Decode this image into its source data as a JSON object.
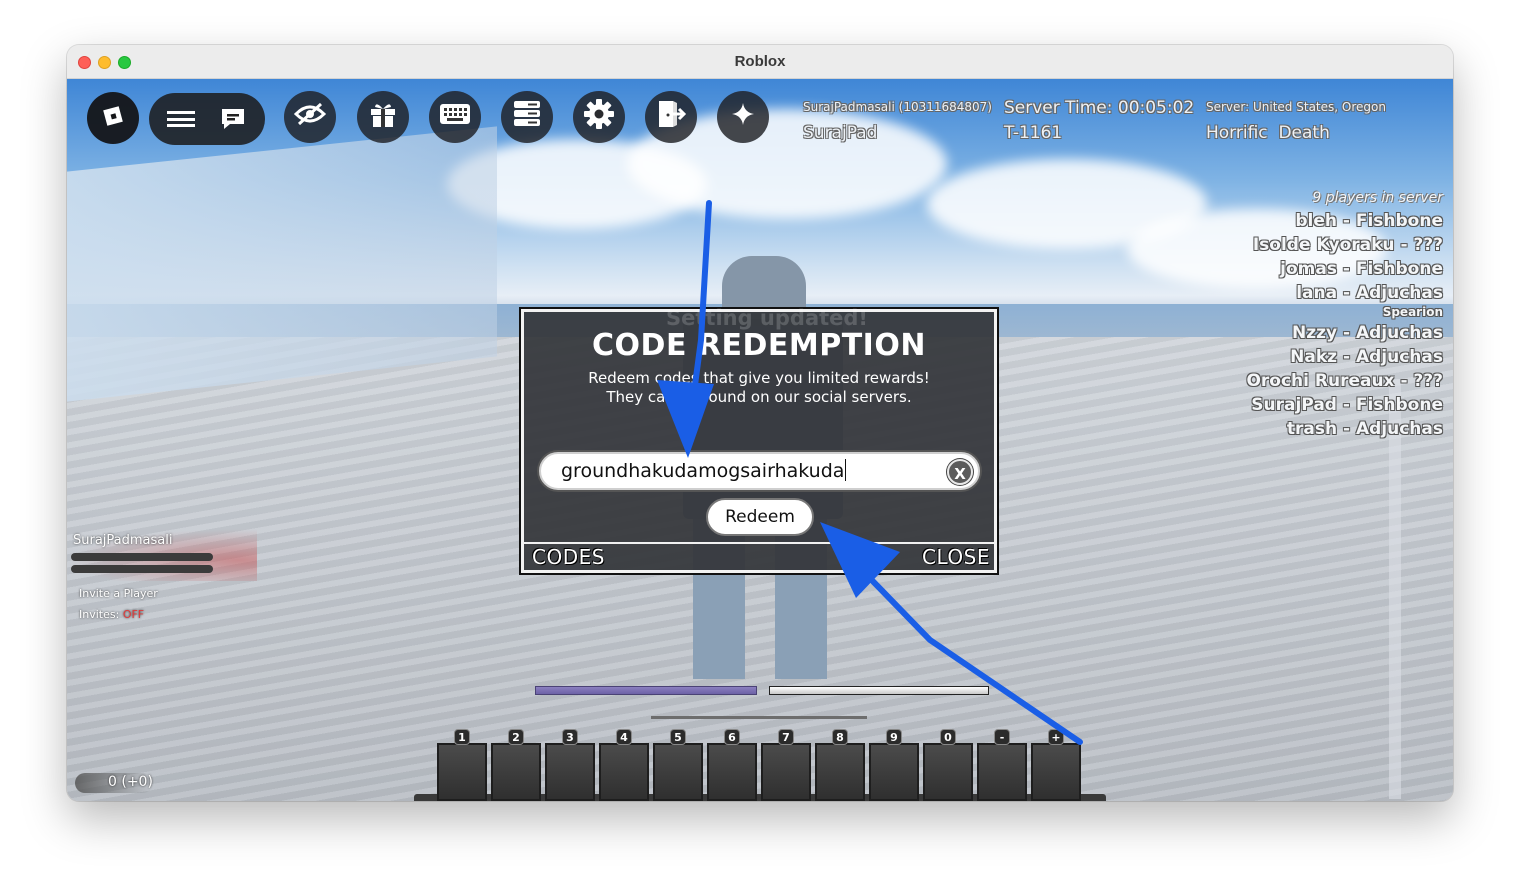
{
  "window": {
    "title": "Roblox"
  },
  "toolbar": {
    "icons": [
      "roblox-logo-icon",
      "menu-icon",
      "chat-icon",
      "hide-icon",
      "gift-icon",
      "keyboard-icon",
      "server-icon",
      "settings-icon",
      "leave-icon",
      "sparkle-icon"
    ]
  },
  "server_info": {
    "user_id": "SurajPadmasali (10311684807)",
    "display_name": "SurajPad",
    "server_time": "Server Time: 00:05:02",
    "server_code": "T-1161",
    "region": "Server: United States, Oregon",
    "difficulty": "Horrific  Death"
  },
  "player_list": {
    "count": "9 players in server",
    "players": [
      {
        "text": "bleh  - Fishbone"
      },
      {
        "text": "Isolde Kyoraku - ???"
      },
      {
        "text": "jomas  - Fishbone"
      },
      {
        "text": "lana  - Adjuchas",
        "sub": "Spearion"
      },
      {
        "text": "Nzzy  - Adjuchas"
      },
      {
        "text": "Nakz  - Adjuchas"
      },
      {
        "text": "Orochi Rureaux - ???"
      },
      {
        "text": "SurajPad  - Fishbone"
      },
      {
        "text": "trash  - Adjuchas"
      }
    ]
  },
  "left_panel": {
    "player_name": "SurajPadmasali",
    "invite_label": "Invite a Player",
    "invites_label": "Invites:",
    "invites_state": "OFF",
    "score": "0 (+0)"
  },
  "hotbar": {
    "slots": [
      "1",
      "2",
      "3",
      "4",
      "5",
      "6",
      "7",
      "8",
      "9",
      "0",
      "-",
      "+"
    ]
  },
  "modal": {
    "background_text": "Setting updated!",
    "title": "CODE REDEMPTION",
    "description_line1": "Redeem codes that give you limited rewards!",
    "description_line2": "They can be found on our social servers.",
    "input_value": "groundhakudamogsairhakuda",
    "clear_label": "X",
    "redeem_label": "Redeem",
    "codes_label": "CODES",
    "close_label": "CLOSE"
  },
  "annotation": {
    "arrow_color": "#1a5ee6"
  }
}
